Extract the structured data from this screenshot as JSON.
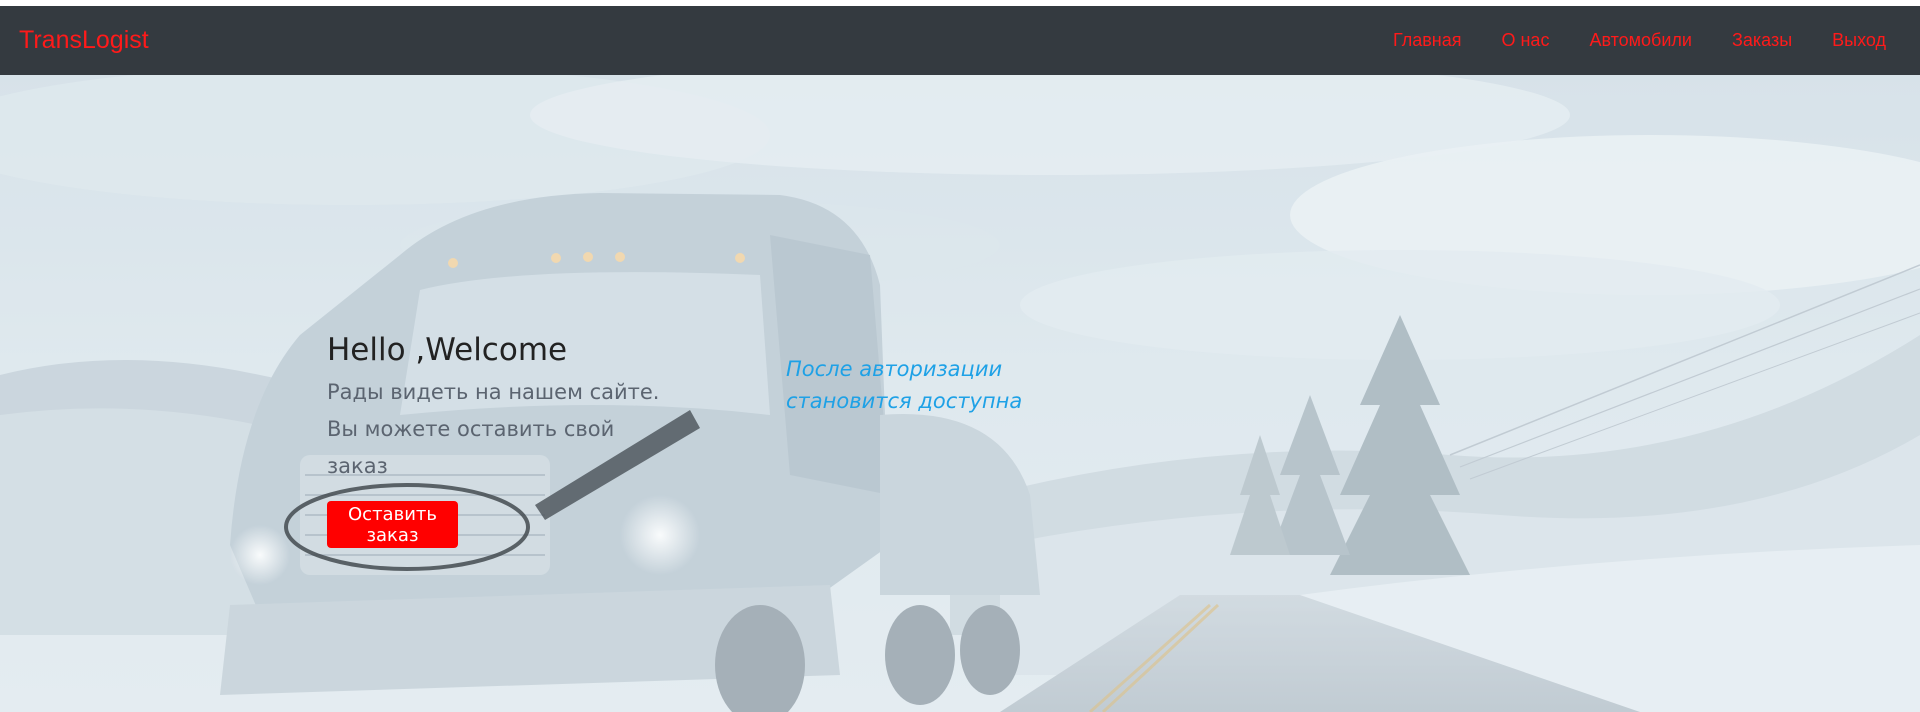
{
  "navbar": {
    "brand": "TransLogist",
    "links": [
      "Главная",
      "О нас",
      "Автомобили",
      "Заказы",
      "Выход"
    ],
    "background_color": "#343a40",
    "link_color": "#ff1a1a"
  },
  "hero": {
    "title": "Hello ,Welcome",
    "lead": "Рады видеть на нашем сайте. Вы можете оставить свой заказ",
    "button_label": "Оставить заказ",
    "button_color": "#ff0000",
    "image_icon": "truck-on-snowy-road-image"
  },
  "annotation": {
    "note": "После авторизации становится доступна",
    "note_color": "#1ea1e6"
  }
}
